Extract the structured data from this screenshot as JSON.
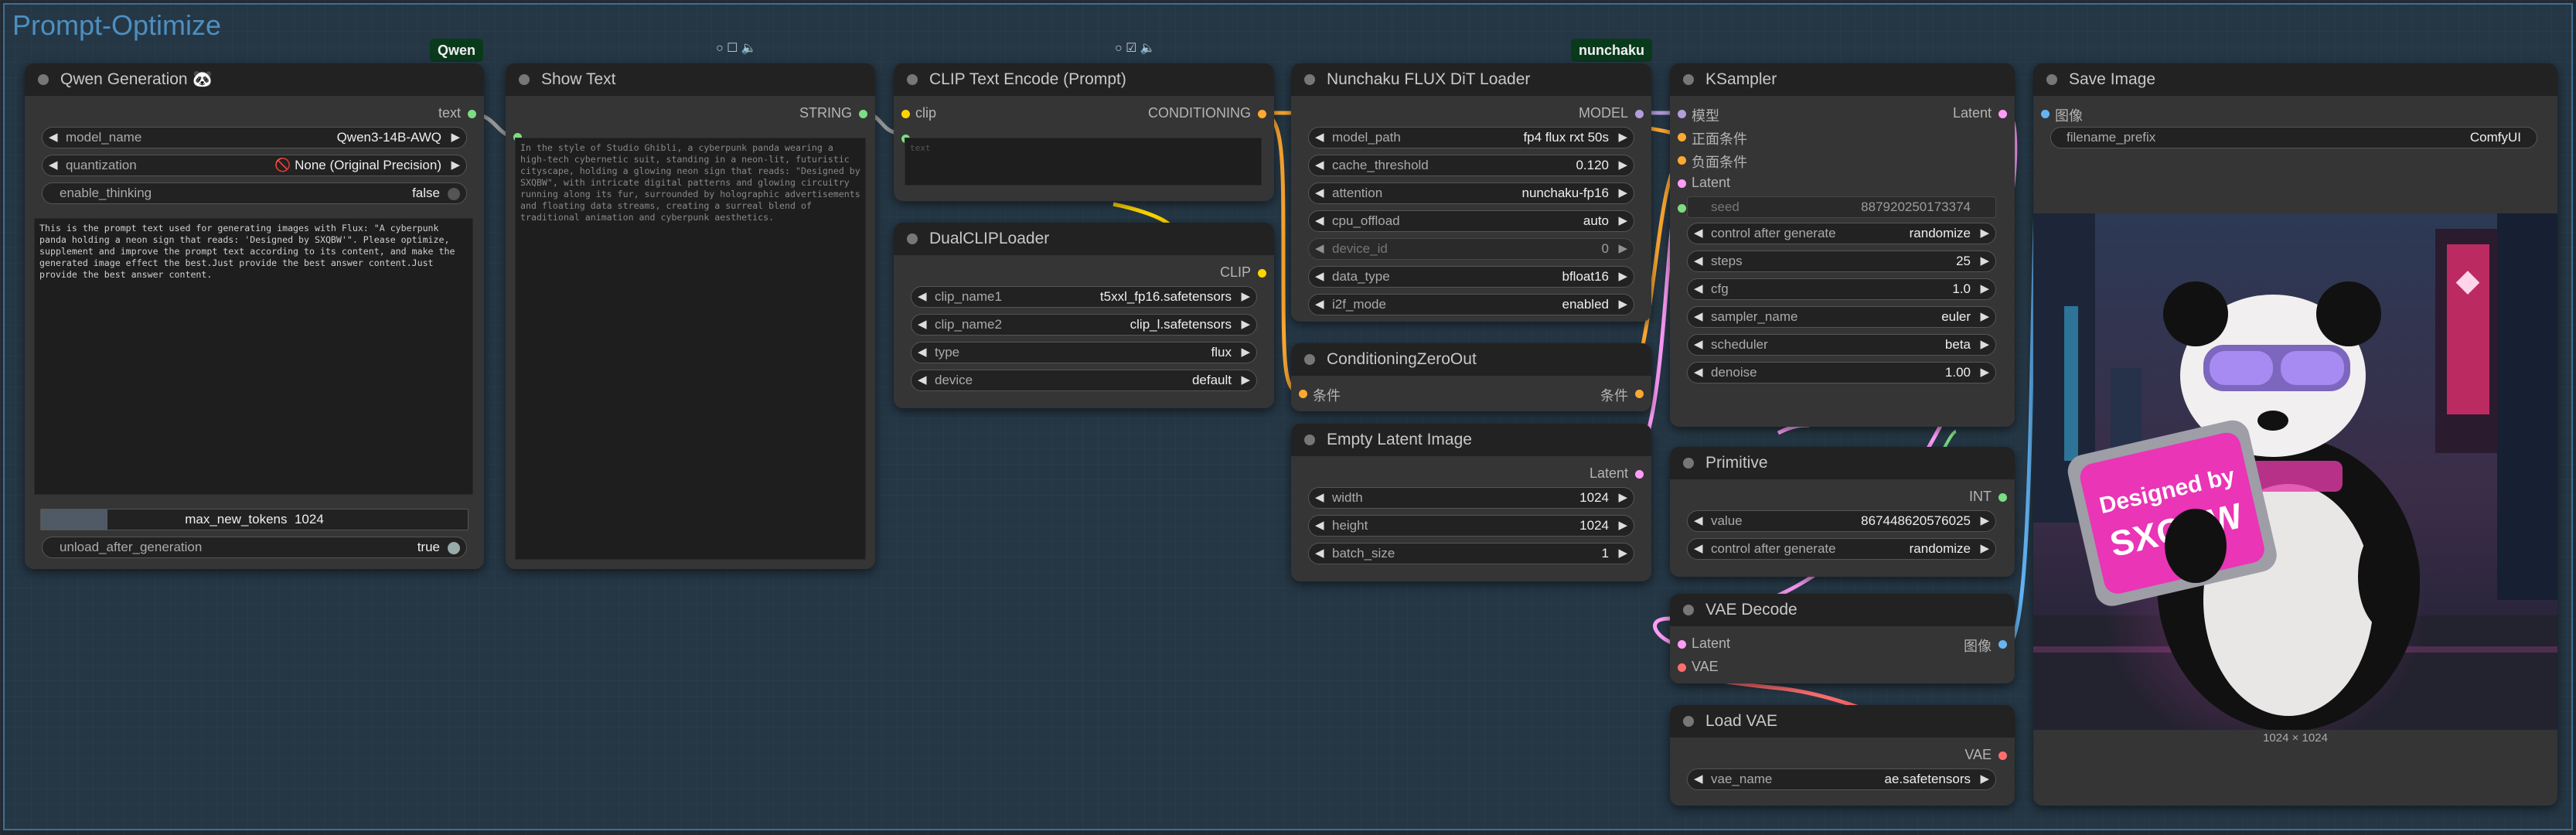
{
  "group": {
    "title": "Prompt-Optimize"
  },
  "badges": {
    "qwen": "Qwen",
    "nunchaku": "nunchaku"
  },
  "qwen_node": {
    "title": "Qwen Generation",
    "emoji": "🐼",
    "output": "text",
    "model_name": {
      "label": "model_name",
      "value": "Qwen3-14B-AWQ"
    },
    "quantization": {
      "label": "quantization",
      "value": "🚫 None (Original Precision)"
    },
    "enable_thinking": {
      "label": "enable_thinking",
      "value": "false"
    },
    "prompt_text": "This is the prompt text used for generating images with Flux: \"A cyberpunk panda holding a neon sign that reads: 'Designed by SXQBW'\". Please optimize, supplement and improve the prompt text according to its content, and make the generated image effect the best.Just provide the best answer content.Just provide the best answer content.",
    "max_new_tokens": {
      "label": "max_new_tokens",
      "value": "1024",
      "fraction": 0.08
    },
    "unload_after_generation": {
      "label": "unload_after_generation",
      "value": "true"
    }
  },
  "show_text_node": {
    "title": "Show Text",
    "output": "STRING",
    "text": "In the style of Studio Ghibli, a cyberpunk panda wearing a high-tech cybernetic suit, standing in a neon-lit, futuristic cityscape, holding a glowing neon sign that reads: \"Designed by SXQBW\", with intricate digital patterns and glowing circuitry running along its fur, surrounded by holographic advertisements and floating data streams, creating a surreal blend of traditional animation and cyberpunk aesthetics."
  },
  "clip_text_node": {
    "title": "CLIP Text Encode (Prompt)",
    "input": "clip",
    "output": "CONDITIONING",
    "placeholder": "text"
  },
  "dual_clip_node": {
    "title": "DualCLIPLoader",
    "output": "CLIP",
    "widgets": [
      {
        "label": "clip_name1",
        "value": "t5xxl_fp16.safetensors"
      },
      {
        "label": "clip_name2",
        "value": "clip_l.safetensors"
      },
      {
        "label": "type",
        "value": "flux"
      },
      {
        "label": "device",
        "value": "default"
      }
    ]
  },
  "nunchaku_node": {
    "title": "Nunchaku FLUX DiT Loader",
    "output": "MODEL",
    "widgets": [
      {
        "label": "model_path",
        "value": "fp4 flux rxt 50s"
      },
      {
        "label": "cache_threshold",
        "value": "0.120"
      },
      {
        "label": "attention",
        "value": "nunchaku-fp16"
      },
      {
        "label": "cpu_offload",
        "value": "auto"
      },
      {
        "label": "device_id",
        "value": "0"
      },
      {
        "label": "data_type",
        "value": "bfloat16"
      },
      {
        "label": "i2f_mode",
        "value": "enabled"
      }
    ]
  },
  "cond_zero_node": {
    "title": "ConditioningZeroOut",
    "input": "条件",
    "output": "条件"
  },
  "empty_latent_node": {
    "title": "Empty Latent Image",
    "output": "Latent",
    "widgets": [
      {
        "label": "width",
        "value": "1024"
      },
      {
        "label": "height",
        "value": "1024"
      },
      {
        "label": "batch_size",
        "value": "1"
      }
    ]
  },
  "ksampler_node": {
    "title": "KSampler",
    "inputs": [
      "模型",
      "正面条件",
      "负面条件",
      "Latent"
    ],
    "output": "Latent",
    "seed": {
      "label": "seed",
      "value": "887920250173374"
    },
    "widgets": [
      {
        "label": "control after generate",
        "value": "randomize"
      },
      {
        "label": "steps",
        "value": "25"
      },
      {
        "label": "cfg",
        "value": "1.0"
      },
      {
        "label": "sampler_name",
        "value": "euler"
      },
      {
        "label": "scheduler",
        "value": "beta"
      },
      {
        "label": "denoise",
        "value": "1.00"
      }
    ]
  },
  "primitive_node": {
    "title": "Primitive",
    "output": "INT",
    "widgets": [
      {
        "label": "value",
        "value": "867448620576025"
      },
      {
        "label": "control after generate",
        "value": "randomize"
      }
    ]
  },
  "vae_decode_node": {
    "title": "VAE Decode",
    "inputs": [
      "Latent",
      "VAE"
    ],
    "output": "图像"
  },
  "load_vae_node": {
    "title": "Load VAE",
    "output": "VAE",
    "widgets": [
      {
        "label": "vae_name",
        "value": "ae.safetensors"
      }
    ]
  },
  "save_image_node": {
    "title": "Save Image",
    "input": "图像",
    "filename_prefix": {
      "label": "filename_prefix",
      "value": "ComfyUI"
    },
    "image_text_line1": "Designed by",
    "image_text_line2": "SXQBW",
    "image_caption": "1024 × 1024"
  },
  "colors": {
    "model": "#b39ddb",
    "clip": "#ffd500",
    "conditioning": "#ffa931",
    "latent": "#ff9cf9",
    "vae": "#ff6e6e",
    "image": "#64b5f6",
    "int": "#7ddc84",
    "string": "#7ddc84"
  }
}
